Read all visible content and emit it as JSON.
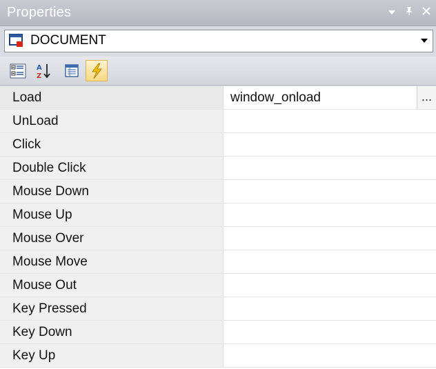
{
  "panel": {
    "title": "Properties",
    "buttons": {
      "dropdown": "▼",
      "pin": "ᵖ",
      "close": "✕"
    }
  },
  "object_selector": {
    "selected": "DOCUMENT"
  },
  "toolbar": {
    "buttons": [
      {
        "name": "categorized-icon",
        "active": false
      },
      {
        "name": "alphabetical-icon",
        "active": false
      },
      {
        "name": "properties-icon",
        "active": false
      },
      {
        "name": "events-icon",
        "active": true
      }
    ]
  },
  "grid": {
    "rows": [
      {
        "name": "Load",
        "value": "window_onload",
        "has_ellipsis": true
      },
      {
        "name": "UnLoad",
        "value": ""
      },
      {
        "name": "Click",
        "value": ""
      },
      {
        "name": "Double Click",
        "value": ""
      },
      {
        "name": "Mouse Down",
        "value": ""
      },
      {
        "name": "Mouse Up",
        "value": ""
      },
      {
        "name": "Mouse Over",
        "value": ""
      },
      {
        "name": "Mouse Move",
        "value": ""
      },
      {
        "name": "Mouse Out",
        "value": ""
      },
      {
        "name": "Key Pressed",
        "value": ""
      },
      {
        "name": "Key Down",
        "value": ""
      },
      {
        "name": "Key Up",
        "value": ""
      }
    ],
    "ellipsis_label": "..."
  }
}
